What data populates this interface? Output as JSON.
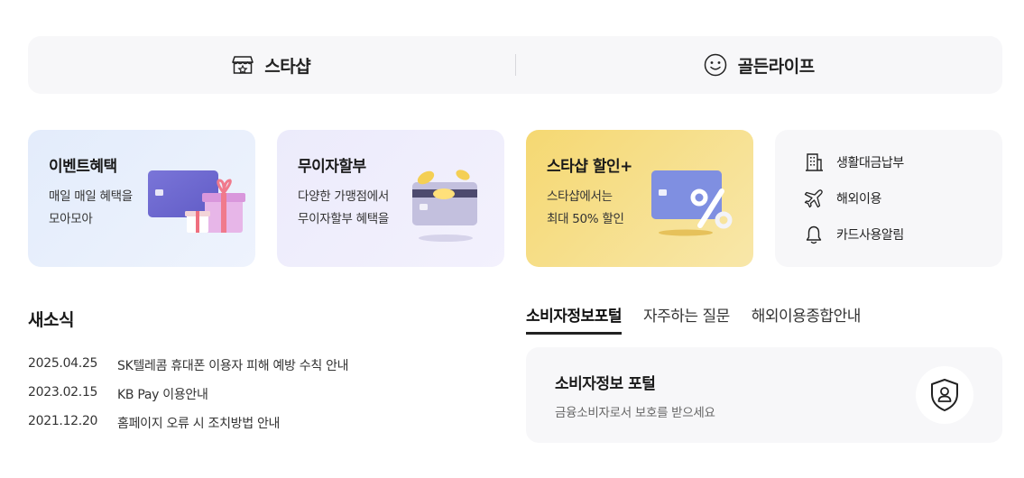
{
  "top_nav": {
    "star_shop": {
      "label": "스타샵",
      "icon": "shop-icon"
    },
    "golden_life": {
      "label": "골든라이프",
      "icon": "smile-icon"
    }
  },
  "promo_cards": [
    {
      "title": "이벤트혜택",
      "desc_line1": "매일 매일 혜택을",
      "desc_line2": "모아모아"
    },
    {
      "title": "무이자할부",
      "desc_line1": "다양한 가맹점에서",
      "desc_line2": "무이자할부 혜택을"
    },
    {
      "title": "스타샵 할인+",
      "desc_line1": "스타샵에서는",
      "desc_line2": "최대 50% 할인"
    }
  ],
  "quick_links": [
    {
      "label": "생활대금납부",
      "icon": "building-icon"
    },
    {
      "label": "해외이용",
      "icon": "airplane-icon"
    },
    {
      "label": "카드사용알림",
      "icon": "bell-icon"
    }
  ],
  "news": {
    "title": "새소식",
    "items": [
      {
        "date": "2025.04.25",
        "text": "SK텔레콤 휴대폰 이용자 피해 예방 수칙 안내"
      },
      {
        "date": "2023.02.15",
        "text": "KB Pay 이용안내"
      },
      {
        "date": "2021.12.20",
        "text": "홈페이지 오류 시 조치방법 안내"
      }
    ]
  },
  "tabs": [
    {
      "label": "소비자정보포털",
      "active": true
    },
    {
      "label": "자주하는 질문",
      "active": false
    },
    {
      "label": "해외이용종합안내",
      "active": false
    }
  ],
  "portal": {
    "title": "소비자정보 포털",
    "desc": "금융소비자로서 보호를 받으세요",
    "icon": "shield-user-icon"
  },
  "colors": {
    "card_purple": "#6f6bd1",
    "card_yellow_bg": "#f5d872",
    "text_dark": "#222222"
  }
}
